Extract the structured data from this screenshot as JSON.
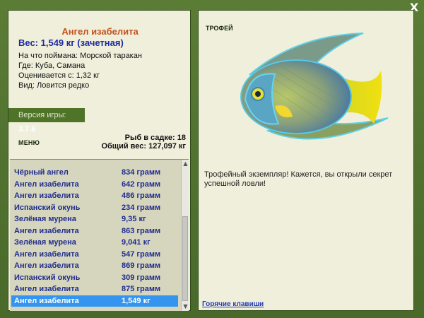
{
  "window": {
    "close_label": "X"
  },
  "fish": {
    "title": "Ангел изабелита",
    "weight": "Вес: 1,549 кг (зачетная)",
    "bait": "На что поймана: Морской таракан",
    "location": "Где: Куба, Самана",
    "valued_from": "Оценивается с: 1,32 кг",
    "rarity": "Вид: Ловится редко"
  },
  "version": {
    "label": "Версия игры:",
    "value": "3.7.6"
  },
  "menu_label": "МЕНЮ",
  "stats": {
    "fish_in_cage": "Рыб в садке: 18",
    "total_weight": "Общий вес: 127,097 кг"
  },
  "catch_list": [
    {
      "name": "Чёрный ангел",
      "weight": "834 грамм"
    },
    {
      "name": "Ангел изабелита",
      "weight": "642 грамм"
    },
    {
      "name": "Ангел изабелита",
      "weight": "486 грамм"
    },
    {
      "name": "Испанский окунь",
      "weight": "234 грамм"
    },
    {
      "name": "Зелёная мурена",
      "weight": "9,35 кг"
    },
    {
      "name": "Ангел изабелита",
      "weight": "863 грамм"
    },
    {
      "name": "Зелёная мурена",
      "weight": "9,041 кг"
    },
    {
      "name": "Ангел изабелита",
      "weight": "547 грамм"
    },
    {
      "name": "Ангел изабелита",
      "weight": "869 грамм"
    },
    {
      "name": "Испанский окунь",
      "weight": "309 грамм"
    },
    {
      "name": "Ангел изабелита",
      "weight": "875 грамм"
    },
    {
      "name": "Ангел изабелита",
      "weight": "1,549 кг"
    }
  ],
  "selected_index": 11,
  "trophy_label": "ТРОФЕЙ",
  "description": "Трофейный экземпляр! Кажется, вы открыли секрет успешной ловли!",
  "hotkeys_link": "Горячие клавиши",
  "icons": {
    "close": "close-icon",
    "scroll_up": "arrow-up-icon",
    "scroll_down": "arrow-down-icon"
  },
  "colors": {
    "frame": "#4a6a2a",
    "panel": "#f0efdc",
    "title": "#c4501a",
    "weight": "#1e2aa0",
    "selected_row": "#3395f0"
  }
}
